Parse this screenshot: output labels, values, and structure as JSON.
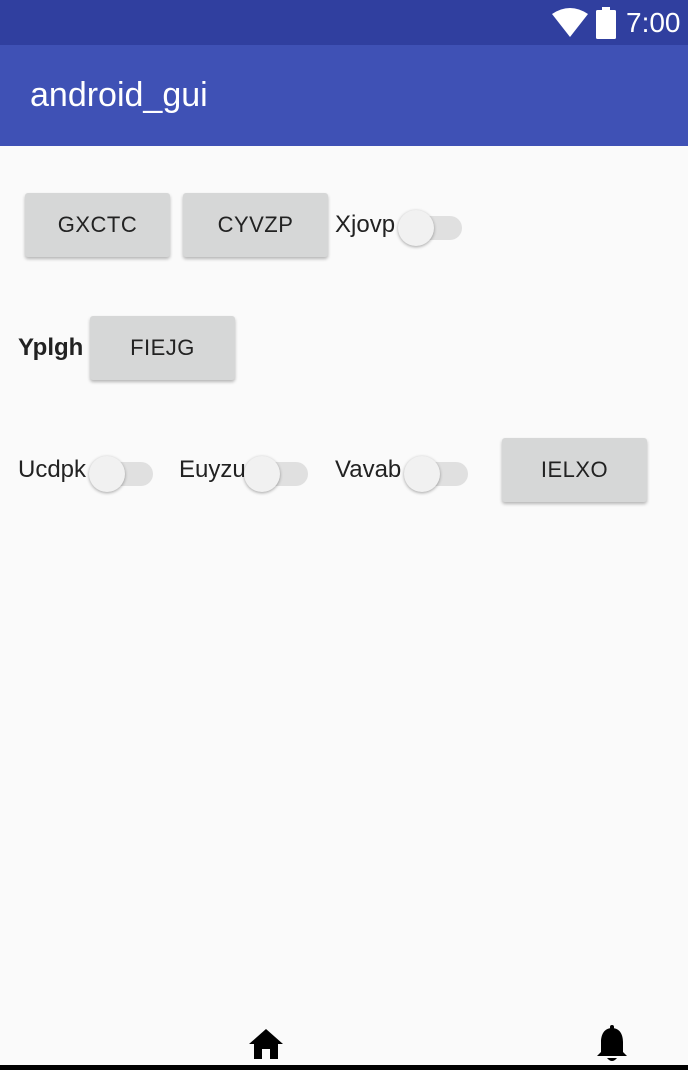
{
  "status_bar": {
    "time": "7:00",
    "icons": [
      "wifi-icon",
      "battery-icon"
    ]
  },
  "app_bar": {
    "title": "android_gui"
  },
  "content": {
    "row1": {
      "button1": "GXCTC",
      "button2": "CYVZP",
      "switch_label": "Xjovp"
    },
    "row2": {
      "label": "Yplgh",
      "button": "FIEJG"
    },
    "row3": {
      "switch1_label": "Ucdpk",
      "switch2_label": "Euyzu",
      "switch3_label": "Vavab",
      "button": "IELXO"
    }
  },
  "bottom_bar": {
    "icons": [
      "home-icon",
      "bell-icon"
    ]
  },
  "colors": {
    "status_bar": "#303f9f",
    "app_bar": "#3f51b5",
    "background": "#fafafa",
    "button": "#d6d7d7"
  }
}
